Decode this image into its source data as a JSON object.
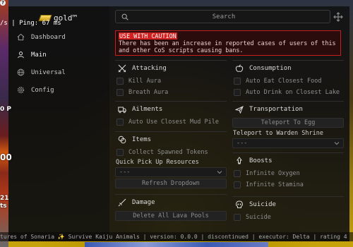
{
  "game": {
    "help_glyph": "?",
    "stat_text": "/s | Ping: 67 ms",
    "left_numbers": [
      "0 P",
      "00",
      "21",
      "ts"
    ]
  },
  "brand": {
    "title": "gold™"
  },
  "nav": {
    "items": [
      {
        "label": "Dashboard",
        "icon": "home-icon"
      },
      {
        "label": "Main",
        "icon": "user-icon"
      },
      {
        "label": "Universal",
        "icon": "globe-icon"
      },
      {
        "label": "Config",
        "icon": "gear-icon"
      }
    ],
    "active": "Main"
  },
  "search": {
    "placeholder": "Search"
  },
  "alert": {
    "title": "USE WITH CAUTION",
    "body": "There has been an increase in reported cases of users of this and other CoS scripts causing bans."
  },
  "sections": {
    "attacking": {
      "title": "Attacking",
      "toggles": [
        "Kill Aura",
        "Breath Aura"
      ]
    },
    "ailments": {
      "title": "Ailments",
      "toggles": [
        "Auto Use Closest Mud Pile"
      ]
    },
    "items": {
      "title": "Items",
      "toggles": [
        "Collect Spawned Tokens"
      ],
      "dropdown_label": "Quick Pick Up Resources",
      "dropdown_value": "---",
      "button": "Refresh Dropdown"
    },
    "damage": {
      "title": "Damage",
      "button": "Delete All Lava Pools"
    },
    "consumption": {
      "title": "Consumption",
      "toggles": [
        "Auto Eat Closest Food",
        "Auto Drink on Closest Lake"
      ]
    },
    "transportation": {
      "title": "Transportation",
      "button": "Teleport To Egg",
      "dropdown_label": "Teleport to Warden Shrine",
      "dropdown_value": "---"
    },
    "boosts": {
      "title": "Boosts",
      "toggles": [
        "Infinite Oxygen",
        "Infinite Stamina"
      ]
    },
    "suicide": {
      "title": "Suicide",
      "toggles": [
        "Suicide"
      ]
    }
  },
  "statusbar": {
    "text": "tures of Sonaria ✨ Survive Kaiju Animals | version: 0.0.0 | discontinued | executor: Delta | rating 4"
  },
  "colors": {
    "accent_gold": "#e8c400",
    "alert_red": "#d21f1f"
  }
}
